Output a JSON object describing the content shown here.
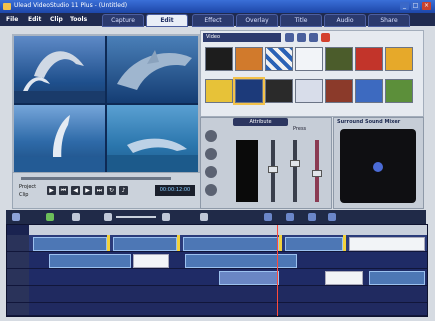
{
  "window": {
    "title": "Ulead VideoStudio 11 Plus - (Untitled)",
    "minimize": "_",
    "maximize": "□",
    "close": "×"
  },
  "menu": {
    "items": [
      "File",
      "Edit",
      "Clip",
      "Tools"
    ],
    "tabs": [
      "Capture",
      "Edit",
      "Effect",
      "Overlay",
      "Title",
      "Audio",
      "Share"
    ],
    "active_tab": "Edit"
  },
  "preview": {
    "project_label": "Project",
    "clip_label": "Clip",
    "timecode": "00:00:12:00"
  },
  "library": {
    "dropdown": "Video",
    "thumb_count_rows": 2
  },
  "audio_panel": {
    "title": "Attribute",
    "label": "Press"
  },
  "surround": {
    "title": "Surround Sound Mixer"
  },
  "colors": {
    "accent": "#2d3b6e",
    "timeline_bg": "#1a2350",
    "clip_blue": "#4d77b5",
    "marker": "#f3d23b"
  }
}
